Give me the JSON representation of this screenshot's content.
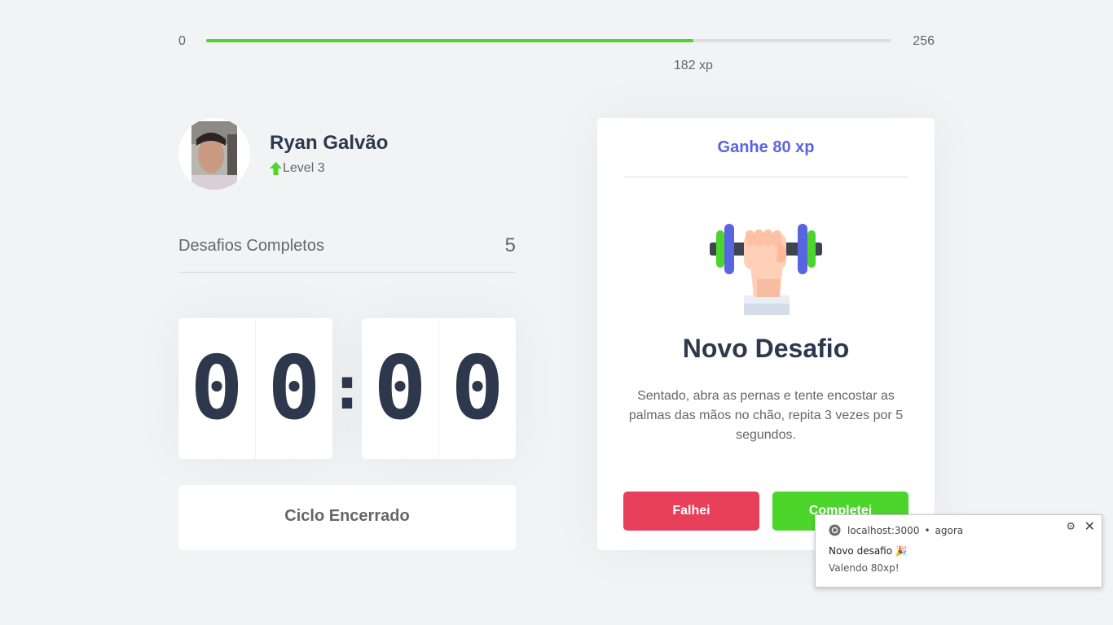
{
  "xp": {
    "min_label": "0",
    "max_label": "256",
    "current_label": "182 xp",
    "current": 182,
    "max": 256,
    "fill_color": "#4cd62b"
  },
  "profile": {
    "name": "Ryan Galvão",
    "level_label": "Level 3",
    "level_icon": "level-up-arrow-icon"
  },
  "completed": {
    "label": "Desafios Completos",
    "count": "5"
  },
  "countdown": {
    "minute_left": "0",
    "minute_right": "0",
    "separator": ":",
    "second_left": "0",
    "second_right": "0"
  },
  "cycle_button": {
    "label": "Ciclo Encerrado"
  },
  "challenge": {
    "header": "Ganhe 80 xp",
    "icon": "dumbbell-body-icon",
    "title": "Novo Desafio",
    "description": "Sentado, abra as pernas e tente encostar as palmas das mãos no chão, repita 3 vezes por 5 segundos.",
    "fail_label": "Falhei",
    "success_label": "Completei",
    "fail_color": "#e83f5b",
    "success_color": "#4cd62b",
    "accent_color": "#5965e0"
  },
  "notification": {
    "origin": "localhost:3000",
    "time": "agora",
    "title": "Novo desafio 🎉",
    "body": "Valendo 80xp!",
    "browser_icon": "chrome-icon"
  }
}
